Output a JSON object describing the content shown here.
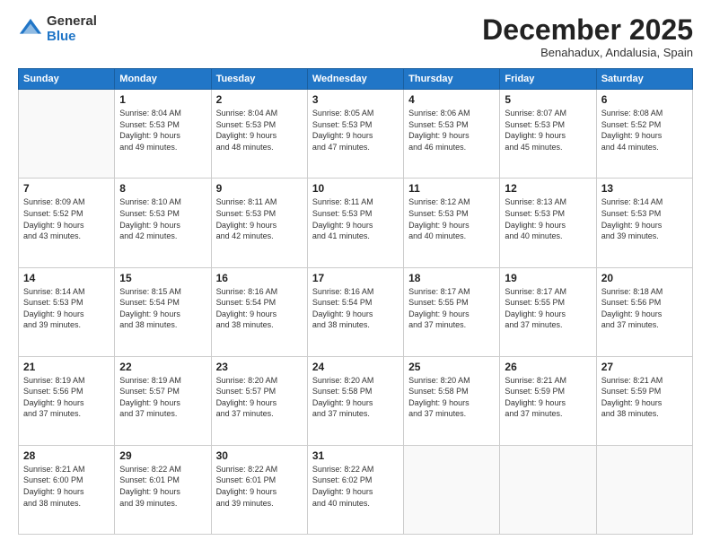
{
  "logo": {
    "general": "General",
    "blue": "Blue"
  },
  "header": {
    "title": "December 2025",
    "subtitle": "Benahadux, Andalusia, Spain"
  },
  "weekdays": [
    "Sunday",
    "Monday",
    "Tuesday",
    "Wednesday",
    "Thursday",
    "Friday",
    "Saturday"
  ],
  "weeks": [
    [
      {
        "day": null
      },
      {
        "day": "1",
        "sunrise": "8:04 AM",
        "sunset": "5:53 PM",
        "daylight": "9 hours and 49 minutes."
      },
      {
        "day": "2",
        "sunrise": "8:04 AM",
        "sunset": "5:53 PM",
        "daylight": "9 hours and 48 minutes."
      },
      {
        "day": "3",
        "sunrise": "8:05 AM",
        "sunset": "5:53 PM",
        "daylight": "9 hours and 47 minutes."
      },
      {
        "day": "4",
        "sunrise": "8:06 AM",
        "sunset": "5:53 PM",
        "daylight": "9 hours and 46 minutes."
      },
      {
        "day": "5",
        "sunrise": "8:07 AM",
        "sunset": "5:53 PM",
        "daylight": "9 hours and 45 minutes."
      },
      {
        "day": "6",
        "sunrise": "8:08 AM",
        "sunset": "5:52 PM",
        "daylight": "9 hours and 44 minutes."
      }
    ],
    [
      {
        "day": "7",
        "sunrise": "8:09 AM",
        "sunset": "5:52 PM",
        "daylight": "9 hours and 43 minutes."
      },
      {
        "day": "8",
        "sunrise": "8:10 AM",
        "sunset": "5:53 PM",
        "daylight": "9 hours and 42 minutes."
      },
      {
        "day": "9",
        "sunrise": "8:11 AM",
        "sunset": "5:53 PM",
        "daylight": "9 hours and 42 minutes."
      },
      {
        "day": "10",
        "sunrise": "8:11 AM",
        "sunset": "5:53 PM",
        "daylight": "9 hours and 41 minutes."
      },
      {
        "day": "11",
        "sunrise": "8:12 AM",
        "sunset": "5:53 PM",
        "daylight": "9 hours and 40 minutes."
      },
      {
        "day": "12",
        "sunrise": "8:13 AM",
        "sunset": "5:53 PM",
        "daylight": "9 hours and 40 minutes."
      },
      {
        "day": "13",
        "sunrise": "8:14 AM",
        "sunset": "5:53 PM",
        "daylight": "9 hours and 39 minutes."
      }
    ],
    [
      {
        "day": "14",
        "sunrise": "8:14 AM",
        "sunset": "5:53 PM",
        "daylight": "9 hours and 39 minutes."
      },
      {
        "day": "15",
        "sunrise": "8:15 AM",
        "sunset": "5:54 PM",
        "daylight": "9 hours and 38 minutes."
      },
      {
        "day": "16",
        "sunrise": "8:16 AM",
        "sunset": "5:54 PM",
        "daylight": "9 hours and 38 minutes."
      },
      {
        "day": "17",
        "sunrise": "8:16 AM",
        "sunset": "5:54 PM",
        "daylight": "9 hours and 38 minutes."
      },
      {
        "day": "18",
        "sunrise": "8:17 AM",
        "sunset": "5:55 PM",
        "daylight": "9 hours and 37 minutes."
      },
      {
        "day": "19",
        "sunrise": "8:17 AM",
        "sunset": "5:55 PM",
        "daylight": "9 hours and 37 minutes."
      },
      {
        "day": "20",
        "sunrise": "8:18 AM",
        "sunset": "5:56 PM",
        "daylight": "9 hours and 37 minutes."
      }
    ],
    [
      {
        "day": "21",
        "sunrise": "8:19 AM",
        "sunset": "5:56 PM",
        "daylight": "9 hours and 37 minutes."
      },
      {
        "day": "22",
        "sunrise": "8:19 AM",
        "sunset": "5:57 PM",
        "daylight": "9 hours and 37 minutes."
      },
      {
        "day": "23",
        "sunrise": "8:20 AM",
        "sunset": "5:57 PM",
        "daylight": "9 hours and 37 minutes."
      },
      {
        "day": "24",
        "sunrise": "8:20 AM",
        "sunset": "5:58 PM",
        "daylight": "9 hours and 37 minutes."
      },
      {
        "day": "25",
        "sunrise": "8:20 AM",
        "sunset": "5:58 PM",
        "daylight": "9 hours and 37 minutes."
      },
      {
        "day": "26",
        "sunrise": "8:21 AM",
        "sunset": "5:59 PM",
        "daylight": "9 hours and 37 minutes."
      },
      {
        "day": "27",
        "sunrise": "8:21 AM",
        "sunset": "5:59 PM",
        "daylight": "9 hours and 38 minutes."
      }
    ],
    [
      {
        "day": "28",
        "sunrise": "8:21 AM",
        "sunset": "6:00 PM",
        "daylight": "9 hours and 38 minutes."
      },
      {
        "day": "29",
        "sunrise": "8:22 AM",
        "sunset": "6:01 PM",
        "daylight": "9 hours and 39 minutes."
      },
      {
        "day": "30",
        "sunrise": "8:22 AM",
        "sunset": "6:01 PM",
        "daylight": "9 hours and 39 minutes."
      },
      {
        "day": "31",
        "sunrise": "8:22 AM",
        "sunset": "6:02 PM",
        "daylight": "9 hours and 40 minutes."
      },
      {
        "day": null
      },
      {
        "day": null
      },
      {
        "day": null
      }
    ]
  ]
}
